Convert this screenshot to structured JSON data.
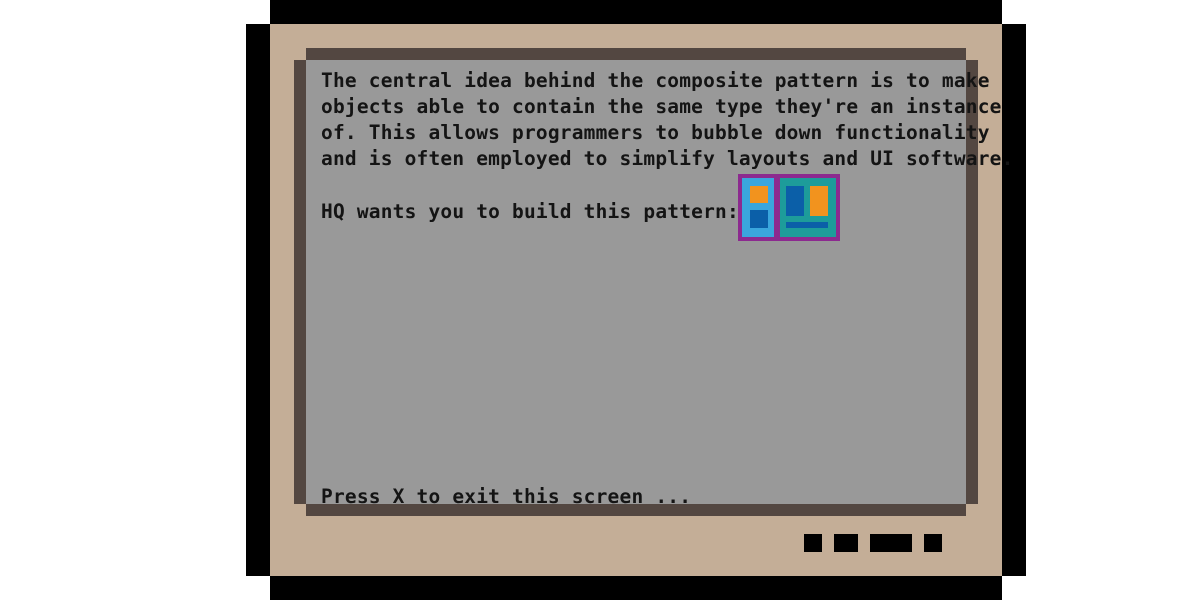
{
  "dialog": {
    "body_lines": [
      "The central idea behind the composite pattern is to make",
      "objects able to contain the same type they're an instance",
      "of. This allows programmers to bubble down functionality",
      "and is often employed to simplify layouts and UI software."
    ],
    "prompt": "HQ wants you to build this pattern:",
    "exit_hint": "Press X to exit this screen ..."
  },
  "pattern_icon": {
    "name": "composite-pattern-icon",
    "colors": {
      "outer_border": "#8c2a8f",
      "left_panel": "#3aa6dd",
      "right_panel": "#1d9c9a",
      "blue_block": "#0b5fa8",
      "orange_block": "#f2931e"
    }
  },
  "colors": {
    "casing": "#c4ae97",
    "casing_outline": "#000000",
    "screen": "#999999",
    "screen_frame": "#534741",
    "text": "#141414"
  }
}
